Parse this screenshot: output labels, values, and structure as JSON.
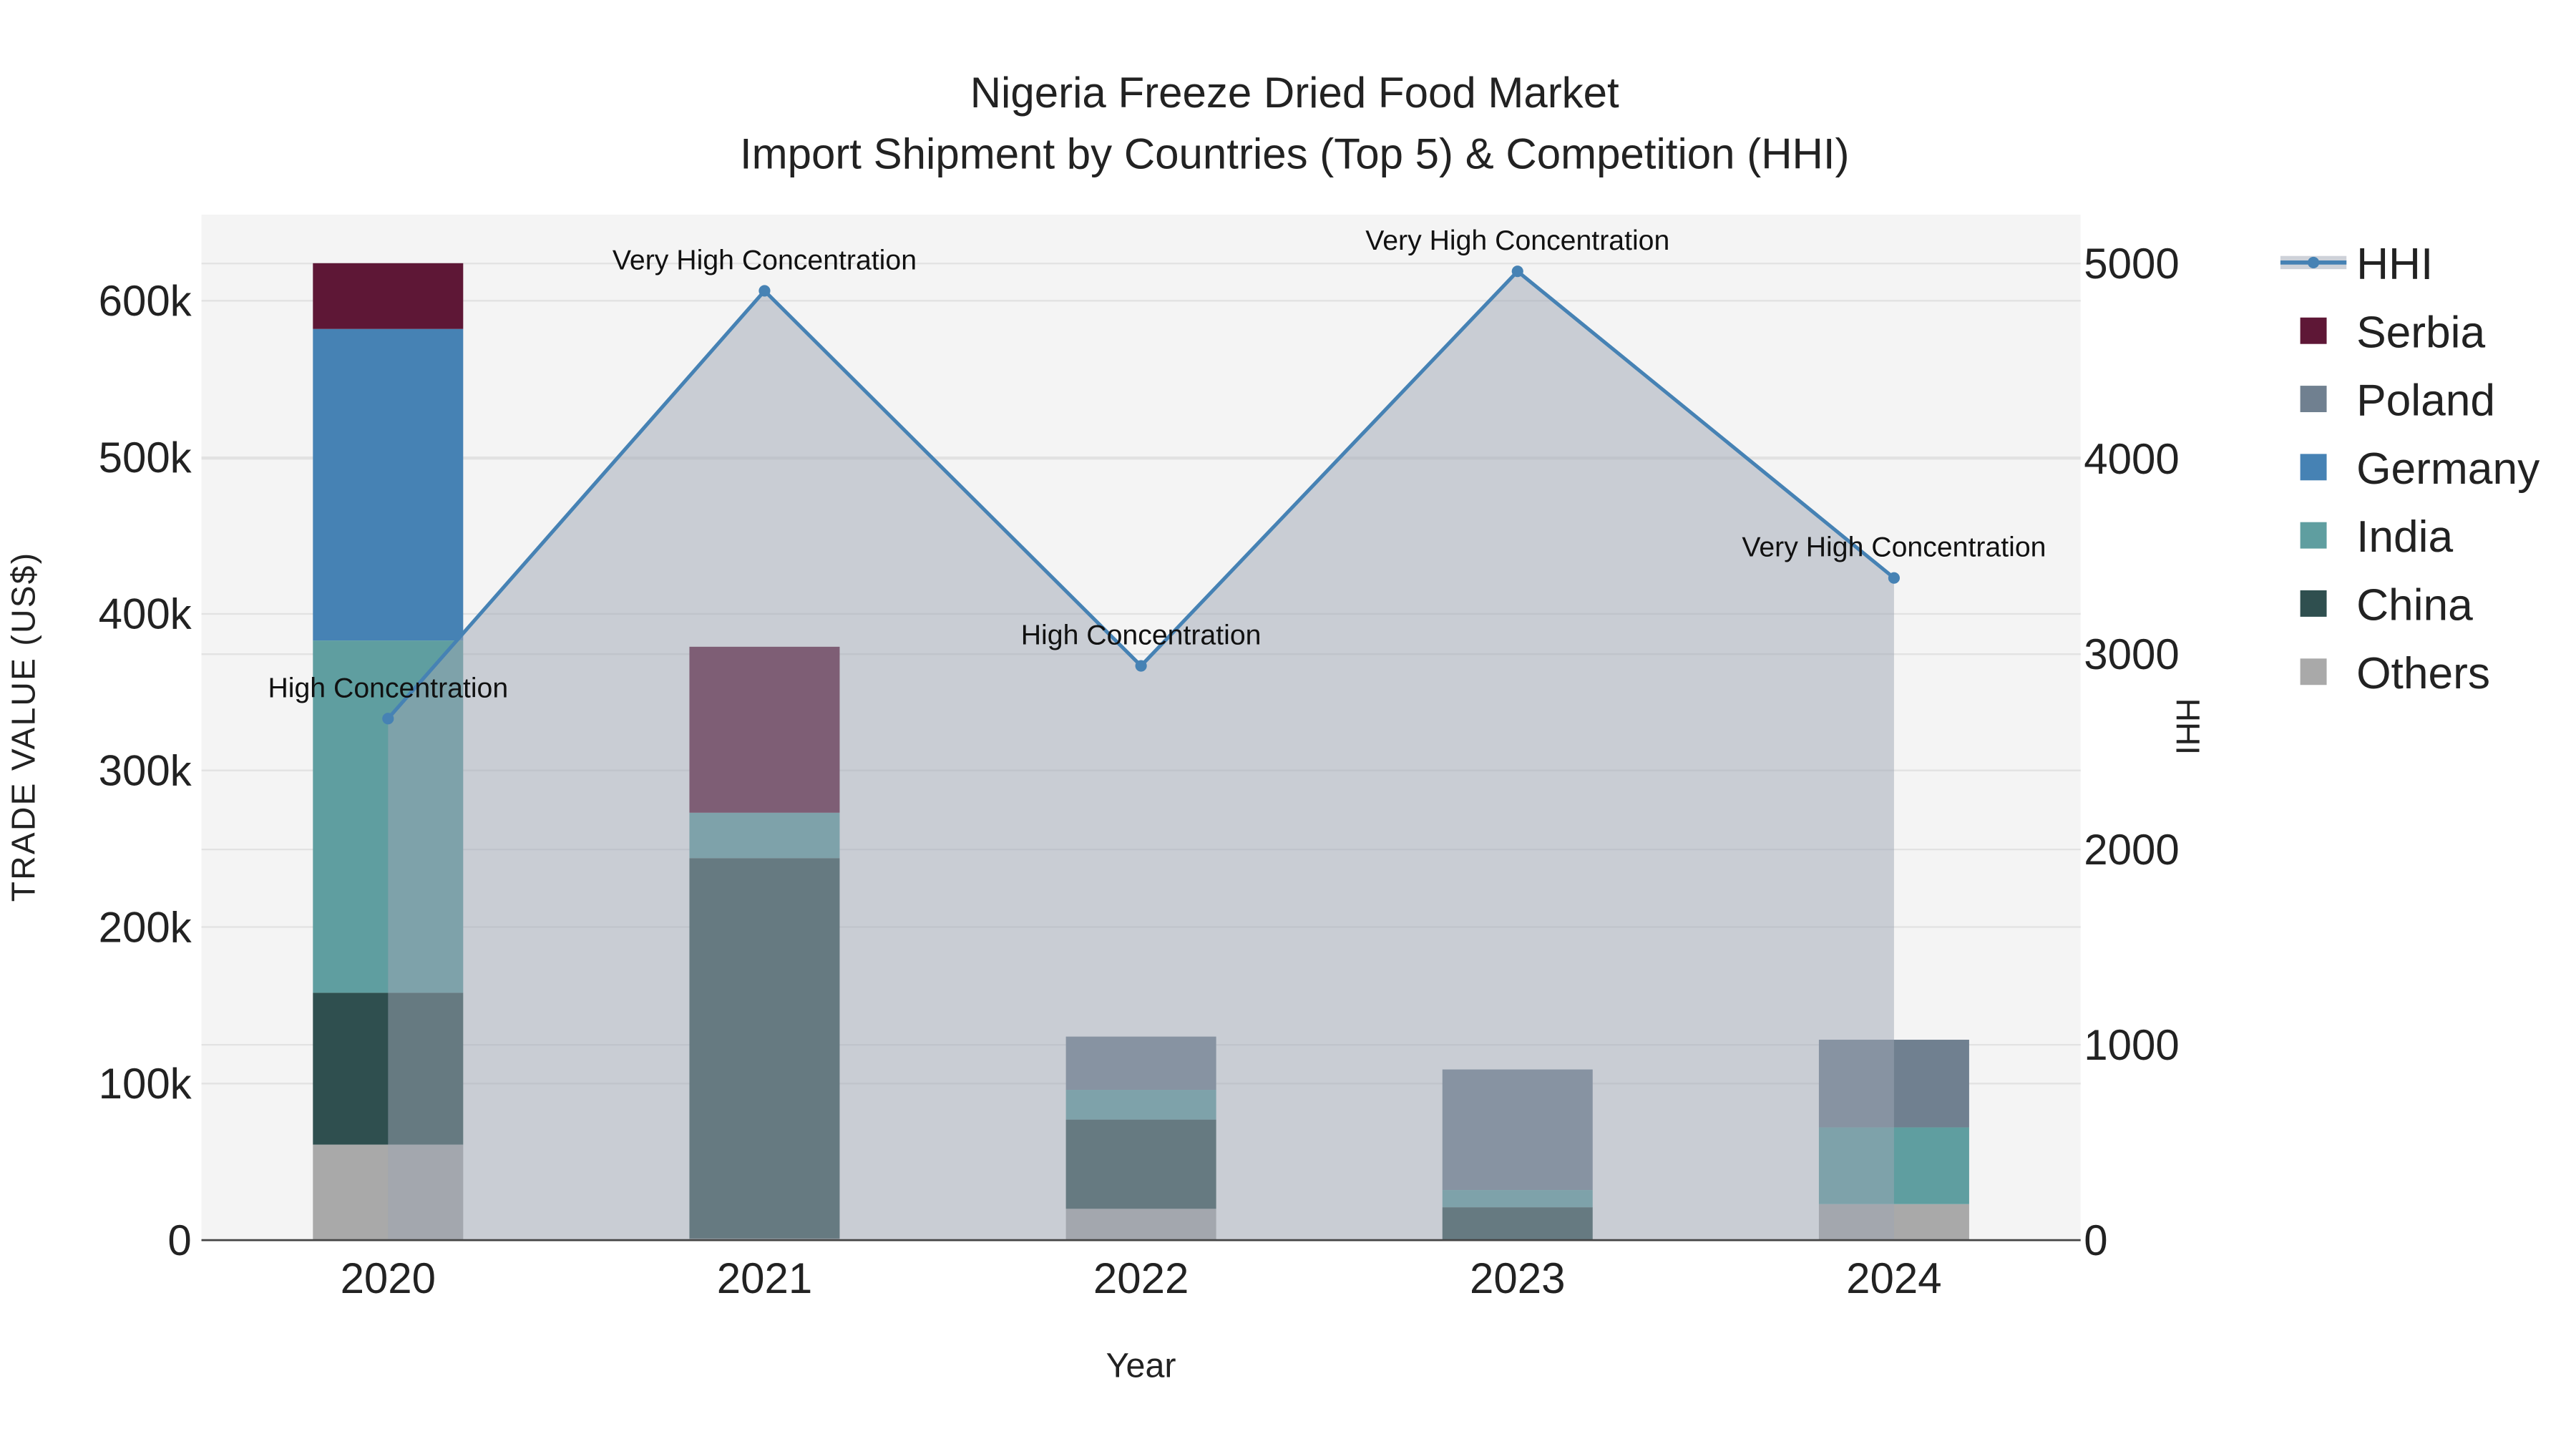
{
  "chart_data": {
    "type": "bar",
    "title": "Nigeria Freeze Dried Food Market",
    "subtitle": "Import Shipment by Countries (Top 5) & Competition (HHI)",
    "xlabel": "Year",
    "ylabel": "TRADE VALUE (US$)",
    "y2label": "HHI",
    "categories": [
      "2020",
      "2021",
      "2022",
      "2023",
      "2024"
    ],
    "ylim": [
      0,
      655000
    ],
    "y2lim": [
      0,
      5250
    ],
    "yticks": [
      0,
      100000,
      200000,
      300000,
      400000,
      500000,
      600000
    ],
    "ytick_labels": [
      "0",
      "100k",
      "200k",
      "300k",
      "400k",
      "500k",
      "600k"
    ],
    "y2ticks": [
      0,
      1000,
      2000,
      3000,
      4000,
      5000
    ],
    "y2tick_labels": [
      "0",
      "1000",
      "2000",
      "3000",
      "4000",
      "5000"
    ],
    "grid": true,
    "legend_position": "right",
    "stacked": true,
    "series": [
      {
        "name": "Others",
        "color": "#a9a9a9",
        "values": [
          61000,
          1000,
          20000,
          0,
          23000
        ]
      },
      {
        "name": "China",
        "color": "#2f4f4f",
        "values": [
          97000,
          243000,
          57000,
          21000,
          0
        ]
      },
      {
        "name": "India",
        "color": "#5f9ea0",
        "values": [
          225000,
          29000,
          19000,
          11000,
          49000
        ]
      },
      {
        "name": "Germany",
        "color": "#4682b4",
        "values": [
          199000,
          0,
          0,
          0,
          0
        ]
      },
      {
        "name": "Poland",
        "color": "#708090",
        "values": [
          0,
          0,
          34000,
          77000,
          56000
        ]
      },
      {
        "name": "Serbia",
        "color": "#5e1736",
        "values": [
          42000,
          106000,
          0,
          0,
          0
        ]
      }
    ],
    "hhi": {
      "name": "HHI",
      "color": "#4682b4",
      "values": [
        2670,
        4860,
        2940,
        4960,
        3390
      ],
      "annotations": [
        "High Concentration",
        "Very High Concentration",
        "High Concentration",
        "Very High Concentration",
        "Very High Concentration"
      ]
    },
    "legend_order": [
      "HHI",
      "Serbia",
      "Poland",
      "Germany",
      "India",
      "China",
      "Others"
    ]
  }
}
